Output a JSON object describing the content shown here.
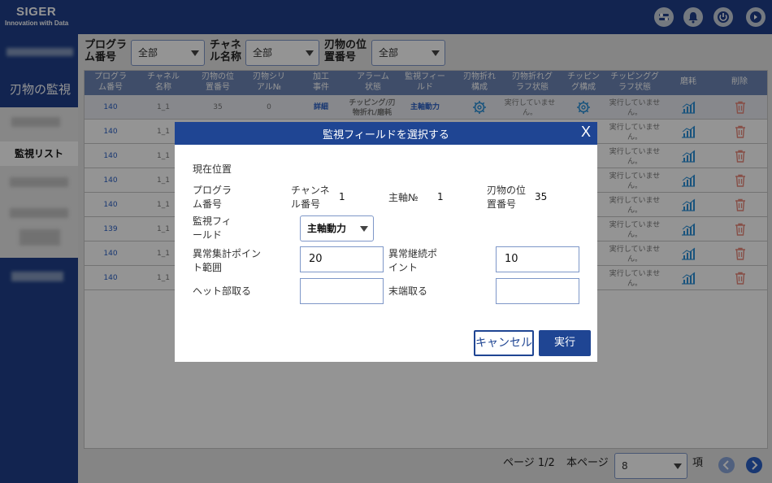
{
  "header": {
    "brand": "SIGER",
    "tagline": "Innovation with Data",
    "icons": [
      "settings-toggle-icon",
      "bell-icon",
      "power-icon",
      "logout-icon"
    ]
  },
  "sidebar": {
    "section_title": "刃物の監視",
    "active_item": "監視リスト"
  },
  "filters": {
    "program": {
      "label": "プログラム番号",
      "value": "全部"
    },
    "channel": {
      "label": "チャネル名称",
      "value": "全部"
    },
    "position": {
      "label": "刃物の位置番号",
      "value": "全部"
    }
  },
  "table": {
    "columns": [
      "プログラム番号",
      "チャネル名称",
      "刃物の位置番号",
      "刃物シリアル№",
      "加工事件",
      "アラーム状態",
      "監視フィールド",
      "刃物折れ構成",
      "刃物折れグラフ状態",
      "チッピング構成",
      "チッピンググラフ状態",
      "磨耗",
      "削除"
    ],
    "first_row": {
      "program": "140",
      "channel": "1_1",
      "position": "35",
      "serial": "0",
      "event": "詳細",
      "alarm": "チッピング/刃物折れ/磨耗",
      "field": "主軸動力",
      "break_graph": "実行していません。",
      "chip_graph": "実行していません。"
    },
    "rows": [
      {
        "program": "140",
        "channel": "1_1",
        "chip_graph": "実行していません。"
      },
      {
        "program": "140",
        "channel": "1_1",
        "chip_graph": "実行していません。"
      },
      {
        "program": "140",
        "channel": "1_1",
        "chip_graph": "実行していません。"
      },
      {
        "program": "140",
        "channel": "1_1",
        "chip_graph": "実行していません。"
      },
      {
        "program": "139",
        "channel": "1_1",
        "chip_graph": "実行していません。"
      },
      {
        "program": "140",
        "channel": "1_1",
        "chip_graph": "実行していません。"
      },
      {
        "program": "140",
        "channel": "1_1",
        "chip_graph": "実行していません。"
      }
    ]
  },
  "pager": {
    "page_text": "ページ 1/2",
    "per_page_label": "本ページ",
    "per_page_value": "8",
    "unit": "項"
  },
  "modal": {
    "title": "監視フィールドを選択する",
    "close": "X",
    "current_position": "現在位置",
    "program_label": "プログラム番号",
    "channel_label": "チャンネル番号",
    "channel_value": "1",
    "spindle_label": "主軸№",
    "spindle_value": "1",
    "blade_label": "刃物の位置番号",
    "blade_value": "35",
    "field_label": "監視フィールド",
    "field_value": "主軸動力",
    "anomaly_range_label": "異常集計ポイント範囲",
    "anomaly_range_value": "20",
    "continuous_label": "異常継続ポイント",
    "continuous_value": "10",
    "head_label": "ヘット部取る",
    "head_value": "",
    "tail_label": "末端取る",
    "tail_value": "",
    "cancel": "キャンセル",
    "run": "実行"
  },
  "colors": {
    "brand": "#1f3f8a",
    "header_row": "#6d86b6",
    "link": "#2a5fc4",
    "delete": "#e8887a"
  }
}
